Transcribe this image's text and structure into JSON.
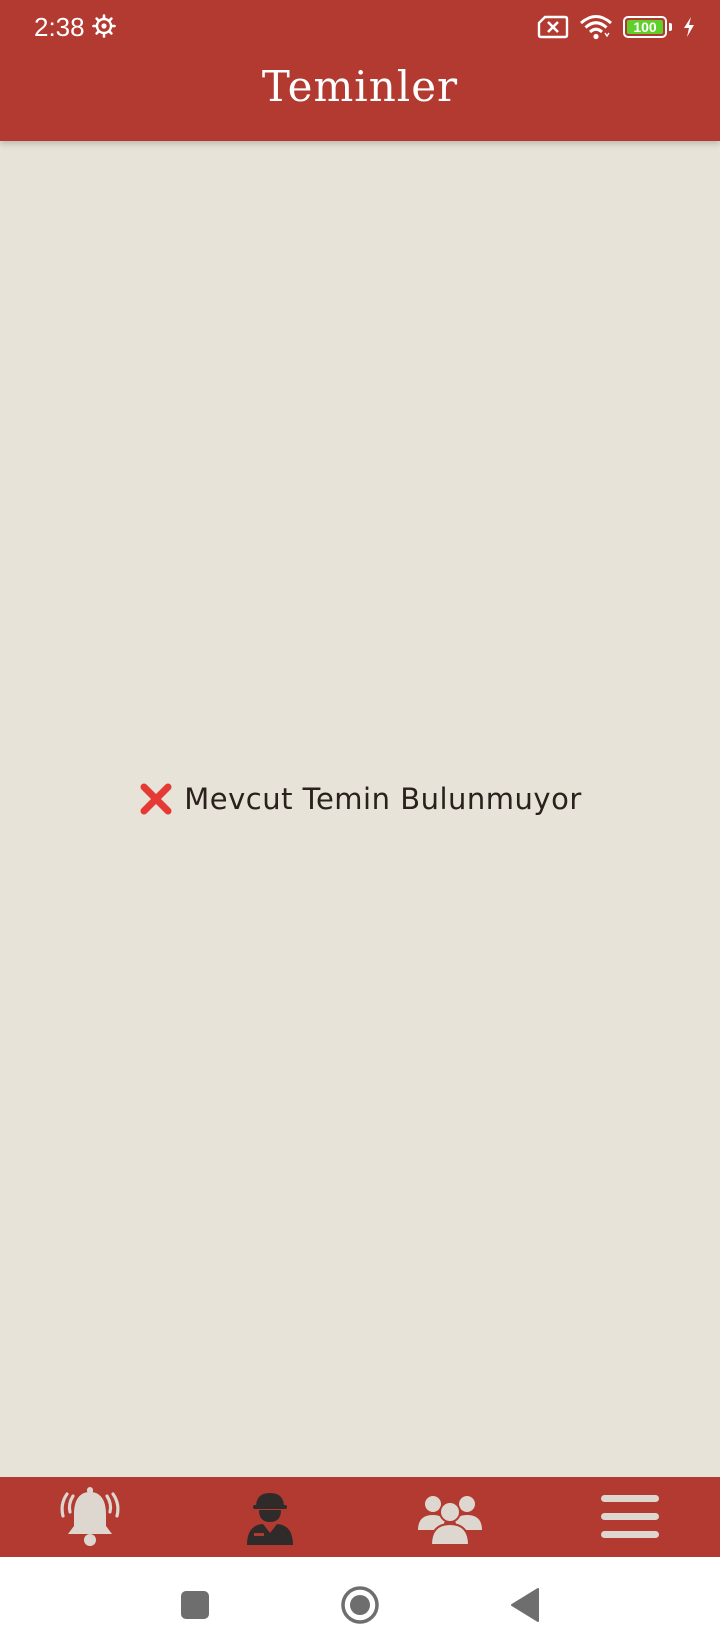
{
  "status_bar": {
    "time": "2:38",
    "battery_level": "100",
    "icons": [
      "gear-icon",
      "sim-error-icon",
      "wifi-icon",
      "battery-icon",
      "charging-icon"
    ]
  },
  "header": {
    "title": "Teminler"
  },
  "empty_state": {
    "icon": "cross-mark-icon",
    "message": "Mevcut Temin Bulunmuyor"
  },
  "bottom_nav": {
    "items": [
      {
        "icon": "alarm-bell-icon",
        "active": false
      },
      {
        "icon": "soldier-icon",
        "active": true
      },
      {
        "icon": "group-icon",
        "active": false
      },
      {
        "icon": "menu-icon",
        "active": false
      }
    ]
  },
  "system_nav": {
    "buttons": [
      "recents-square-icon",
      "home-circle-icon",
      "back-triangle-icon"
    ]
  },
  "colors": {
    "primary": "#b23a30",
    "background": "#e7e3d8",
    "nav_inactive": "#ddd7cf",
    "nav_active": "#2f2b2a",
    "cross": "#e53935"
  }
}
